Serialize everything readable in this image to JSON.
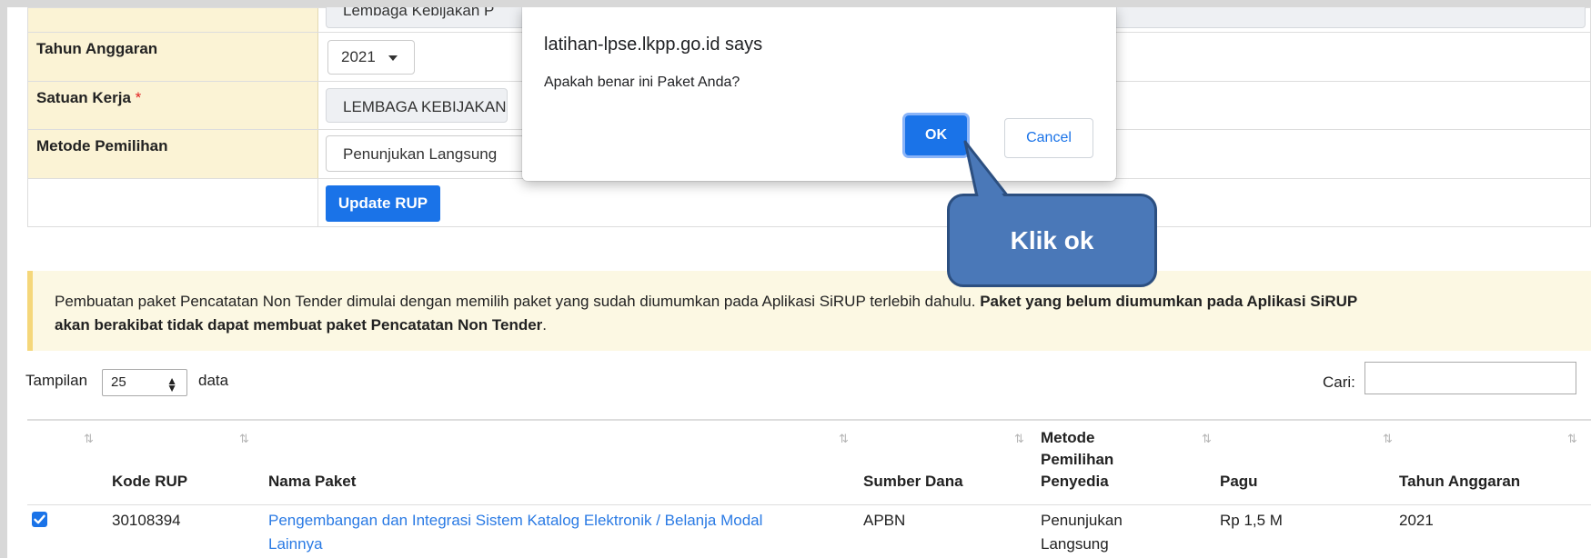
{
  "form": {
    "top_value_cut": "Lembaga Kebijakan P",
    "tahun_anggaran": {
      "label": "Tahun Anggaran",
      "value": "2021"
    },
    "satuan_kerja": {
      "label": "Satuan Kerja",
      "required_mark": "*",
      "value": "LEMBAGA KEBIJAKAN"
    },
    "metode_pemilihan": {
      "label": "Metode Pemilihan",
      "value": "Penunjukan Langsung"
    },
    "update_button": "Update RUP"
  },
  "alert": {
    "text_normal": "Pembuatan paket Pencatatan Non Tender dimulai dengan memilih paket yang sudah diumumkan pada Aplikasi SiRUP terlebih dahulu.",
    "text_bold_1": "Paket yang belum diumumkan pada Aplikasi SiRUP",
    "text_bold_2": "akan berakibat tidak dapat membuat paket Pencatatan Non Tender",
    "period": "."
  },
  "controls": {
    "show_label": "Tampilan",
    "show_value": "25",
    "show_suffix": "data",
    "search_label": "Cari:",
    "search_value": ""
  },
  "table": {
    "columns": {
      "kode_rup": "Kode RUP",
      "nama_paket": "Nama Paket",
      "sumber_dana": "Sumber Dana",
      "metode_1": "Metode",
      "metode_2": "Pemilihan",
      "metode_3": "Penyedia",
      "pagu": "Pagu",
      "tahun_anggaran": "Tahun Anggaran"
    },
    "sort_icon": "⇅",
    "rows": [
      {
        "checked": true,
        "kode_rup": "30108394",
        "nama_paket_1": "Pengembangan dan Integrasi Sistem Katalog Elektronik / Belanja Modal",
        "nama_paket_2": "Lainnya",
        "sumber_dana": "APBN",
        "metode_1": "Penunjukan",
        "metode_2": "Langsung",
        "pagu": "Rp 1,5 M",
        "tahun_anggaran": "2021"
      }
    ]
  },
  "dialog": {
    "origin": "latihan-lpse.lkpp.go.id says",
    "message": "Apakah benar ini Paket Anda?",
    "ok": "OK",
    "cancel": "Cancel"
  },
  "callout": {
    "text": "Klik ok"
  },
  "colors": {
    "primary": "#1a73e8",
    "label_bg": "#fbf3d5",
    "alert_bg": "#fcf8e3",
    "callout": "#4a78b8",
    "link": "#2a7ae4"
  }
}
